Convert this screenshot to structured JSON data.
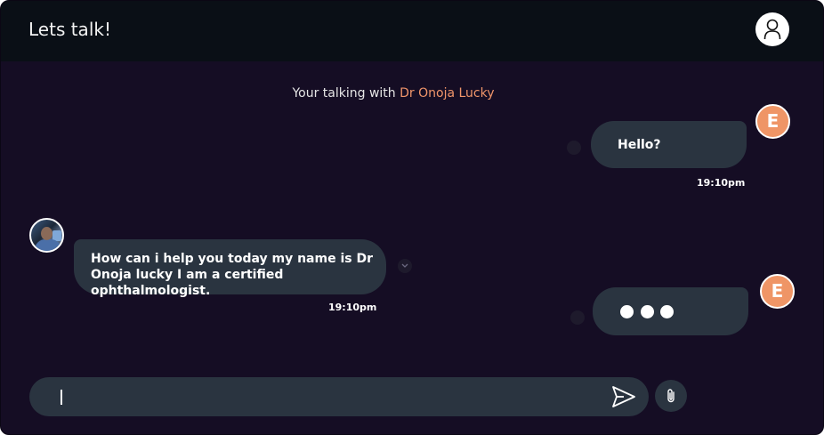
{
  "header": {
    "title": "Lets talk!",
    "avatar_icon": "user-icon"
  },
  "banner": {
    "prefix": "Your talking with ",
    "doctor_name": "Dr Onoja Lucky"
  },
  "messages": [
    {
      "direction": "outgoing",
      "avatar_letter": "E",
      "text": "Hello?",
      "time": "19:10pm"
    },
    {
      "direction": "incoming",
      "avatar": "doctor-avatar",
      "text": "How can i help you today my name is Dr Onoja lucky I am  a certified ophthalmologist.",
      "time": "19:10pm"
    },
    {
      "direction": "outgoing",
      "avatar_letter": "E",
      "typing": true
    }
  ],
  "composer": {
    "value": "",
    "send_icon": "send-icon",
    "attach_icon": "paperclip-icon"
  },
  "colors": {
    "background": "#150d24",
    "header": "#0a0f16",
    "bubble": "#2a3440",
    "accent": "#ef9566",
    "doctor_name": "#f0956a"
  }
}
